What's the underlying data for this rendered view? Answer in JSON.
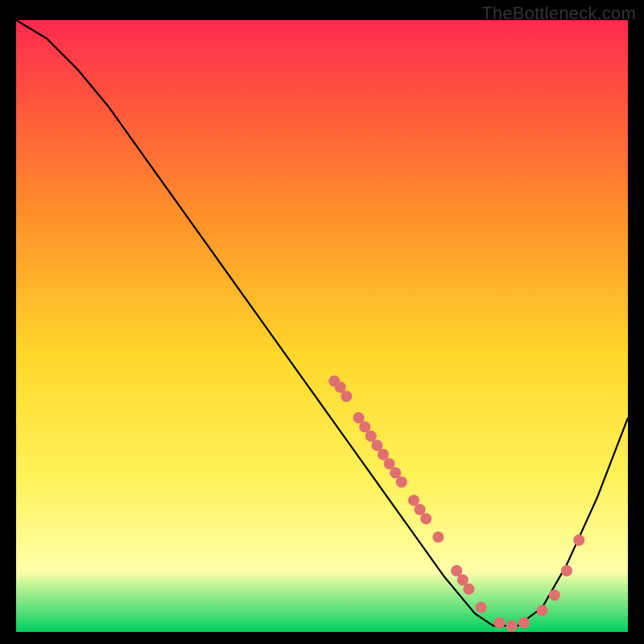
{
  "watermark": "TheBottleneck.com",
  "colors": {
    "bg": "#000000",
    "curve": "#000000",
    "marker": "#e07070",
    "grad_top": "#ff2a4d",
    "grad_mid1": "#ff8a2a",
    "grad_mid2": "#ffd82a",
    "grad_mid3": "#fff25a",
    "grad_mid4": "#ffffa8",
    "grad_bottom": "#00d060"
  },
  "chart_data": {
    "type": "line",
    "title": "",
    "xlabel": "",
    "ylabel": "",
    "xlim": [
      0,
      100
    ],
    "ylim": [
      0,
      100
    ],
    "curve": [
      {
        "x": 0,
        "y": 100
      },
      {
        "x": 5,
        "y": 97
      },
      {
        "x": 10,
        "y": 92
      },
      {
        "x": 15,
        "y": 86
      },
      {
        "x": 20,
        "y": 79
      },
      {
        "x": 25,
        "y": 72
      },
      {
        "x": 30,
        "y": 65
      },
      {
        "x": 35,
        "y": 58
      },
      {
        "x": 40,
        "y": 51
      },
      {
        "x": 45,
        "y": 44
      },
      {
        "x": 50,
        "y": 37
      },
      {
        "x": 55,
        "y": 30
      },
      {
        "x": 60,
        "y": 23
      },
      {
        "x": 65,
        "y": 16
      },
      {
        "x": 70,
        "y": 9
      },
      {
        "x": 75,
        "y": 3
      },
      {
        "x": 78,
        "y": 1
      },
      {
        "x": 82,
        "y": 1
      },
      {
        "x": 86,
        "y": 4
      },
      {
        "x": 90,
        "y": 11
      },
      {
        "x": 95,
        "y": 22
      },
      {
        "x": 100,
        "y": 35
      }
    ],
    "markers": [
      {
        "x": 52,
        "y": 41
      },
      {
        "x": 53,
        "y": 40
      },
      {
        "x": 54,
        "y": 38.5
      },
      {
        "x": 56,
        "y": 35
      },
      {
        "x": 57,
        "y": 33.5
      },
      {
        "x": 58,
        "y": 32
      },
      {
        "x": 59,
        "y": 30.5
      },
      {
        "x": 60,
        "y": 29
      },
      {
        "x": 61,
        "y": 27.5
      },
      {
        "x": 62,
        "y": 26
      },
      {
        "x": 63,
        "y": 24.5
      },
      {
        "x": 65,
        "y": 21.5
      },
      {
        "x": 66,
        "y": 20
      },
      {
        "x": 67,
        "y": 18.5
      },
      {
        "x": 69,
        "y": 15.5
      },
      {
        "x": 72,
        "y": 10
      },
      {
        "x": 73,
        "y": 8.5
      },
      {
        "x": 74,
        "y": 7
      },
      {
        "x": 76,
        "y": 4
      },
      {
        "x": 79,
        "y": 1.5
      },
      {
        "x": 81,
        "y": 1
      },
      {
        "x": 83,
        "y": 1.5
      },
      {
        "x": 86,
        "y": 3.5
      },
      {
        "x": 88,
        "y": 6
      },
      {
        "x": 90,
        "y": 10
      },
      {
        "x": 92,
        "y": 15
      }
    ]
  }
}
